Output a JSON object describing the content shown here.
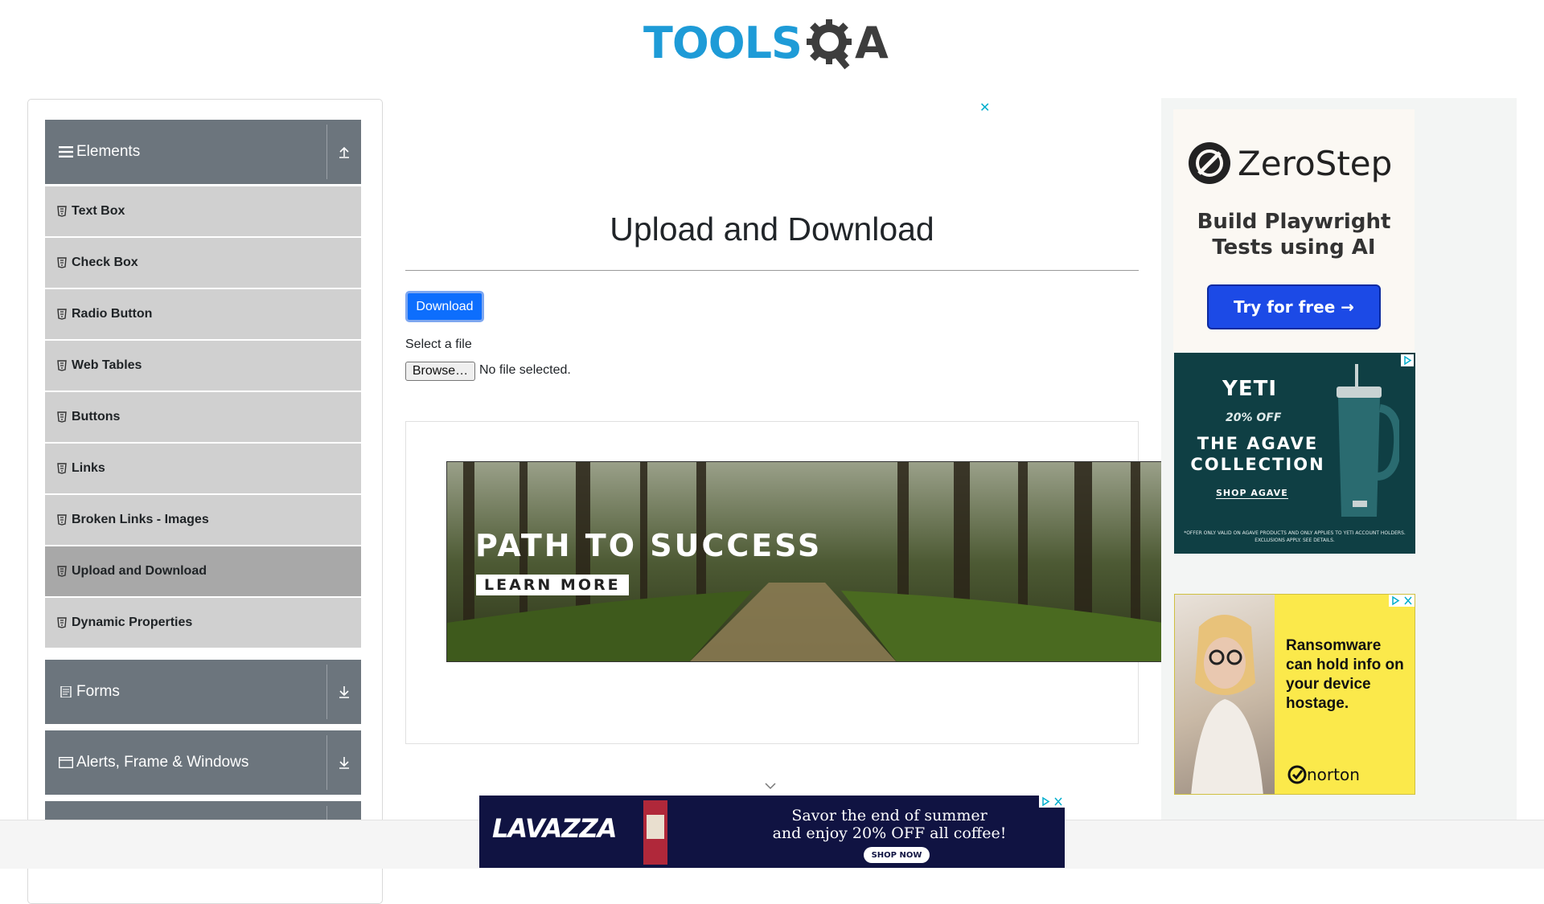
{
  "header": {
    "logo_text_left": "TOOLS",
    "logo_text_right": "A",
    "logo_gear": "gear-q-icon"
  },
  "sidebar": {
    "groups": [
      {
        "label": "Elements",
        "icon": "hamburger-icon",
        "toggle_icon": "collapse-up-icon",
        "expanded": true
      },
      {
        "label": "Forms",
        "icon": "form-icon",
        "toggle_icon": "expand-down-icon",
        "expanded": false
      },
      {
        "label": "Alerts, Frame & Windows",
        "icon": "window-icon",
        "toggle_icon": "expand-down-icon",
        "expanded": false
      }
    ],
    "items": [
      {
        "label": "Text Box"
      },
      {
        "label": "Check Box"
      },
      {
        "label": "Radio Button"
      },
      {
        "label": "Web Tables"
      },
      {
        "label": "Buttons"
      },
      {
        "label": "Links"
      },
      {
        "label": "Broken Links - Images"
      },
      {
        "label": "Upload and Download",
        "active": true
      },
      {
        "label": "Dynamic Properties"
      }
    ]
  },
  "main": {
    "title": "Upload and Download",
    "download_label": "Download",
    "select_label": "Select a file",
    "browse_label": "Browse…",
    "file_status": "No file selected.",
    "ad_close": "✕"
  },
  "ads": {
    "banner": {
      "headline": "PATH TO SUCCESS",
      "cta": "LEARN MORE"
    },
    "zerostep": {
      "brand": "ZeroStep",
      "line1": "Build Playwright",
      "line2": "Tests using AI",
      "cta": "Try for free →"
    },
    "yeti": {
      "brand": "YETI",
      "offer": "20% OFF",
      "collection": "THE AGAVE COLLECTION",
      "shop": "SHOP AGAVE",
      "fine_print": "*OFFER ONLY VALID ON AGAVE PRODUCTS AND ONLY APPLIES TO YETI ACCOUNT HOLDERS. EXCLUSIONS APPLY. SEE DETAILS."
    },
    "norton": {
      "text": "Ransomware can hold info on your device hostage.",
      "brand": "norton"
    },
    "lavazza": {
      "brand": "LAVAZZA",
      "line1": "Savor the end of summer",
      "line2": "and enjoy 20% OFF all coffee!",
      "cta": "SHOP NOW"
    }
  },
  "colors": {
    "accent": "#0d6efd",
    "sidebar_header": "#6c757d",
    "menu_item": "#d0d0d0",
    "menu_item_active": "#a8a8a8",
    "logo_blue": "#1e9bd7"
  }
}
